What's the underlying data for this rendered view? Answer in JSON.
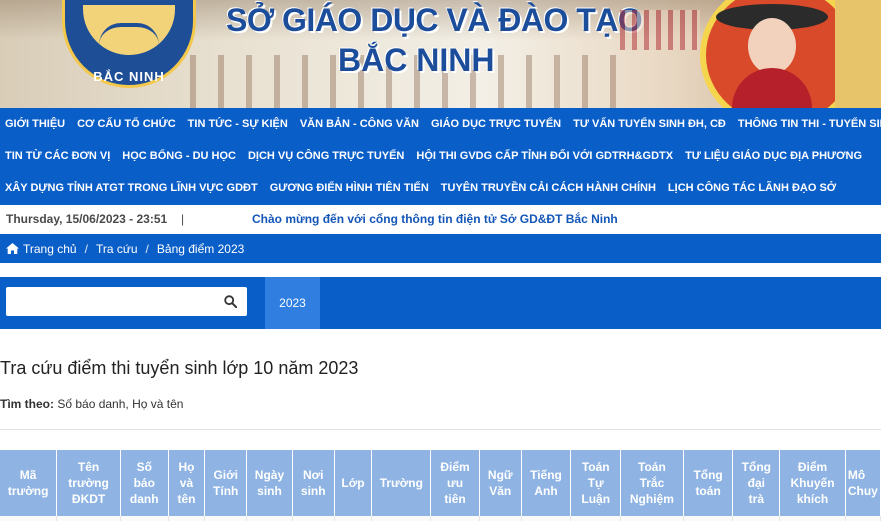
{
  "banner": {
    "logo_text": "BẮC NINH",
    "title_line1": "SỞ GIÁO DỤC VÀ ĐÀO TẠO",
    "title_line2": "BẮC NINH"
  },
  "nav": {
    "row1": [
      "GIỚI THIỆU",
      "CƠ CẤU TỔ CHỨC",
      "TIN TỨC - SỰ KIỆN",
      "VĂN BẢN - CÔNG VĂN",
      "GIÁO DỤC TRỰC TUYẾN",
      "TƯ VẤN TUYỂN SINH ĐH, CĐ",
      "THÔNG TIN THI - TUYỂN SINH"
    ],
    "row2": [
      "TIN TỪ CÁC ĐƠN VỊ",
      "HỌC BỔNG - DU HỌC",
      "DỊCH VỤ CÔNG TRỰC TUYẾN",
      "HỘI THI GVDG CẤP TỈNH ĐỐI VỚI GDTRH&GDTX",
      "TƯ LIỆU GIÁO DỤC ĐỊA PHƯƠNG"
    ],
    "row3": [
      "XÂY DỰNG TỈNH ATGT TRONG LĨNH VỰC GDĐT",
      "GƯƠNG ĐIỂN HÌNH TIÊN TIẾN",
      "TUYÊN TRUYỀN CẢI CÁCH HÀNH CHÍNH",
      "LỊCH CÔNG TÁC LÃNH ĐẠO SỞ"
    ]
  },
  "ticker": {
    "date": "Thursday, 15/06/2023 - 23:51",
    "separator": "|",
    "message": "Chào mừng đến với cổng thông tin điện tử Sở GD&ĐT Bắc Ninh"
  },
  "breadcrumb": {
    "home": "Trang chủ",
    "lookup": "Tra cứu",
    "current": "Bảng điểm 2023",
    "sep": "/"
  },
  "search": {
    "placeholder": "",
    "year_tab": "2023"
  },
  "content": {
    "title": "Tra cứu điểm thi tuyển sinh lớp 10 năm 2023",
    "search_by_label": "Tìm theo:",
    "search_by_value": " Số báo danh, Họ và tên"
  },
  "table": {
    "headers": [
      {
        "l1": "Mã",
        "l2": "trường",
        "l3": ""
      },
      {
        "l1": "Tên",
        "l2": "trường",
        "l3": "ĐKDT"
      },
      {
        "l1": "Số",
        "l2": "báo",
        "l3": "danh"
      },
      {
        "l1": "Họ",
        "l2": "và",
        "l3": "tên"
      },
      {
        "l1": "Giới",
        "l2": "Tính",
        "l3": ""
      },
      {
        "l1": "Ngày",
        "l2": "sinh",
        "l3": ""
      },
      {
        "l1": "Nơi",
        "l2": "sinh",
        "l3": ""
      },
      {
        "l1": "Lớp",
        "l2": "",
        "l3": ""
      },
      {
        "l1": "Trường",
        "l2": "",
        "l3": ""
      },
      {
        "l1": "Điểm",
        "l2": "ưu",
        "l3": "tiên"
      },
      {
        "l1": "Ngữ",
        "l2": "Văn",
        "l3": ""
      },
      {
        "l1": "Tiếng",
        "l2": "Anh",
        "l3": ""
      },
      {
        "l1": "Toán",
        "l2": "Tự",
        "l3": "Luận"
      },
      {
        "l1": "Toán",
        "l2": "Trắc",
        "l3": "Nghiệm"
      },
      {
        "l1": "Tổng",
        "l2": "toán",
        "l3": ""
      },
      {
        "l1": "Tổng",
        "l2": "đại",
        "l3": "trà"
      },
      {
        "l1": "Điểm",
        "l2": "Khuyến",
        "l3": "khích"
      },
      {
        "l1": "Mô",
        "l2": "Chuy",
        "l3": ""
      }
    ]
  },
  "colors": {
    "primary_blue": "#0a5ec8",
    "tab_blue": "#2f7ee0",
    "table_header": "#8fb4e3",
    "title_blue": "#1b4d9b",
    "ticker_blue": "#1456b8"
  }
}
